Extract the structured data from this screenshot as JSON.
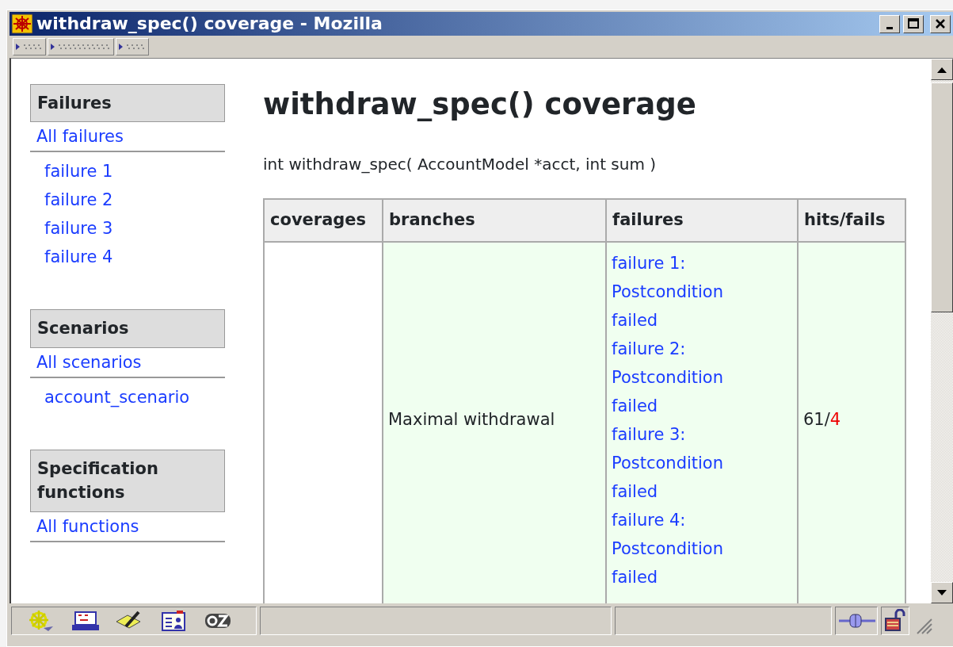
{
  "window": {
    "title": "withdraw_spec() coverage - Mozilla"
  },
  "sidebar": {
    "sections": [
      {
        "title": "Failures",
        "all_link": "All failures",
        "items": [
          "failure 1",
          "failure 2",
          "failure 3",
          "failure 4"
        ]
      },
      {
        "title": "Scenarios",
        "all_link": "All scenarios",
        "items": [
          "account_scenario"
        ]
      },
      {
        "title": "Specification functions",
        "all_link": "All functions"
      }
    ]
  },
  "heading": "withdraw_spec() coverage",
  "signature": "int withdraw_spec( AccountModel *acct, int sum )",
  "table": {
    "columns": [
      "coverages",
      "branches",
      "failures",
      "hits/fails"
    ],
    "rows": [
      {
        "coverage": "",
        "branch": "Maximal withdrawal",
        "failures": [
          "failure 1: Postcondition failed",
          "failure 2: Postcondition failed",
          "failure 3: Postcondition failed",
          "failure 4: Postcondition failed"
        ],
        "hits": "61",
        "separator": "/",
        "fails": "4"
      }
    ]
  }
}
